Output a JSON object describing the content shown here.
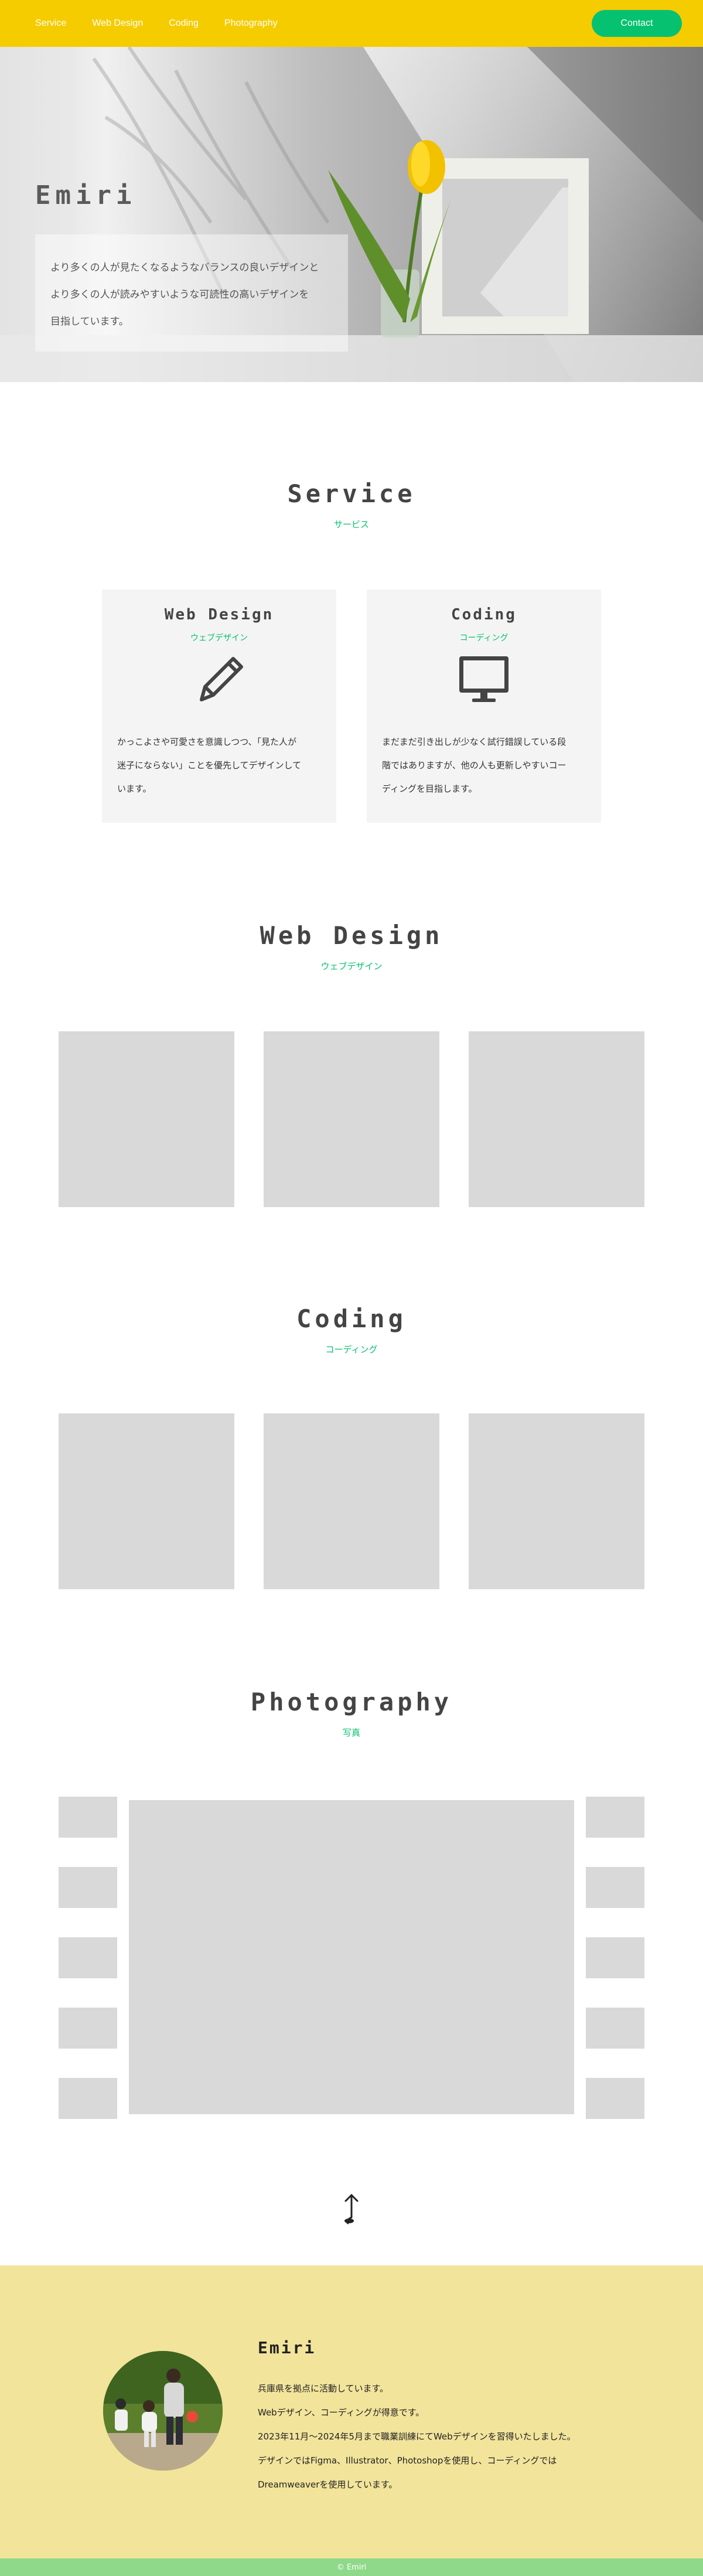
{
  "nav": {
    "links": [
      "Service",
      "Web Design",
      "Coding",
      "Photography"
    ],
    "contact_label": "Contact"
  },
  "hero": {
    "title": "Emiri",
    "lines": [
      "より多くの人が見たくなるようなバランスの良いデザインと",
      "より多くの人が読みやすいような可読性の高いデザインを",
      "目指しています。"
    ]
  },
  "service": {
    "title": "Service",
    "subtitle": "サービス",
    "cards": [
      {
        "title": "Web Design",
        "subtitle": "ウェブデザイン",
        "icon": "pencil-icon",
        "lines": [
          "かっこよさや可愛さを意識しつつ、「見た人が",
          "迷子にならない」ことを優先してデザインして",
          "います。"
        ]
      },
      {
        "title": "Coding",
        "subtitle": "コーディング",
        "icon": "monitor-icon",
        "lines": [
          "まだまだ引き出しが少なく試行錯誤している段",
          "階ではありますが、他の人も更新しやすいコー",
          "ディングを目指します。"
        ]
      }
    ]
  },
  "webdesign": {
    "title": "Web Design",
    "subtitle": "ウェブデザイン"
  },
  "coding": {
    "title": "Coding",
    "subtitle": "コーディング"
  },
  "photography": {
    "title": "Photography",
    "subtitle": "写真"
  },
  "profile": {
    "name": "Emiri",
    "lines": [
      "兵庫県を拠点に活動しています。",
      "Webデザイン、コーディングが得意です。",
      "2023年11月～2024年5月まで職業訓練にてWebデザインを習得いたしました。",
      "デザインではFigma、Illustrator、Photoshopを使用し、コーディングでは",
      "Dreamweaverを使用しています。"
    ]
  },
  "footer": {
    "copyright": "© Emiri"
  },
  "colors": {
    "nav_bg": "#f5cc00",
    "accent_green": "#06c270",
    "profile_bg": "#f2e49b",
    "footer_bg": "#8fd98a",
    "placeholder_gray": "#d9d9d9"
  }
}
